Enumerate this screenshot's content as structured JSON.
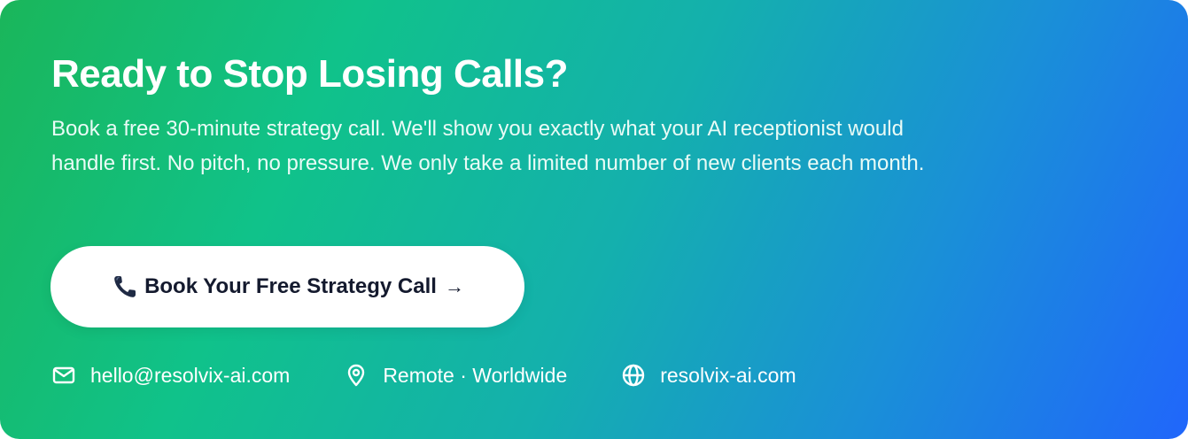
{
  "headline": "Ready to Stop Losing Calls?",
  "description": "Book a free 30-minute strategy call. We'll show you exactly what your AI receptionist would handle first. No pitch, no pressure. We only take a limited number of new clients each month.",
  "cta": {
    "icon": "phone-icon",
    "label": "Book Your Free Strategy Call",
    "arrow": "→"
  },
  "contacts": {
    "email": {
      "icon": "mail-icon",
      "text": "hello@resolvix-ai.com"
    },
    "location": {
      "icon": "map-pin-icon",
      "text": "Remote · Worldwide"
    },
    "website": {
      "icon": "globe-icon",
      "text": "resolvix-ai.com"
    }
  },
  "colors": {
    "gradient_start": "#1ab65a",
    "gradient_mid": "#14b0ad",
    "gradient_end": "#2066fb",
    "button_bg": "#ffffff",
    "button_text": "#141a2e",
    "text": "#ffffff"
  }
}
